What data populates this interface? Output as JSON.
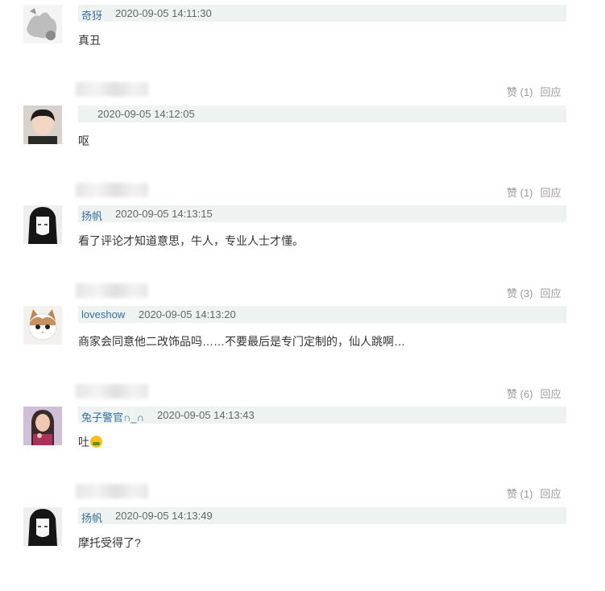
{
  "comments": [
    {
      "username": "奇犽",
      "time": "2020-09-05 14:11:30",
      "text": "真丑",
      "likes": "",
      "reply": ""
    },
    {
      "username": "",
      "time": "2020-09-05 14:12:05",
      "text": "呕",
      "likes": "赞 (1)",
      "reply": "回应"
    },
    {
      "username": "扬帆",
      "time": "2020-09-05 14:13:15",
      "text": "看了评论才知道意思，牛人，专业人士才懂。",
      "likes": "赞 (1)",
      "reply": "回应"
    },
    {
      "username": "loveshow",
      "time": "2020-09-05 14:13:20",
      "text": "商家会同意他二改饰品吗……不要最后是专门定制的，仙人跳啊…",
      "likes": "赞 (3)",
      "reply": "回应"
    },
    {
      "username": "兔子警官∩_∩",
      "time": "2020-09-05 14:13:43",
      "text": "吐",
      "likes": "赞 (6)",
      "reply": "回应"
    },
    {
      "username": "扬帆",
      "time": "2020-09-05 14:13:49",
      "text": "摩托受得了?",
      "likes": "赞 (1)",
      "reply": "回应"
    }
  ],
  "colors": {
    "meta_bar": "#eef3f1",
    "username": "#3a6e9e",
    "muted": "#999999"
  }
}
